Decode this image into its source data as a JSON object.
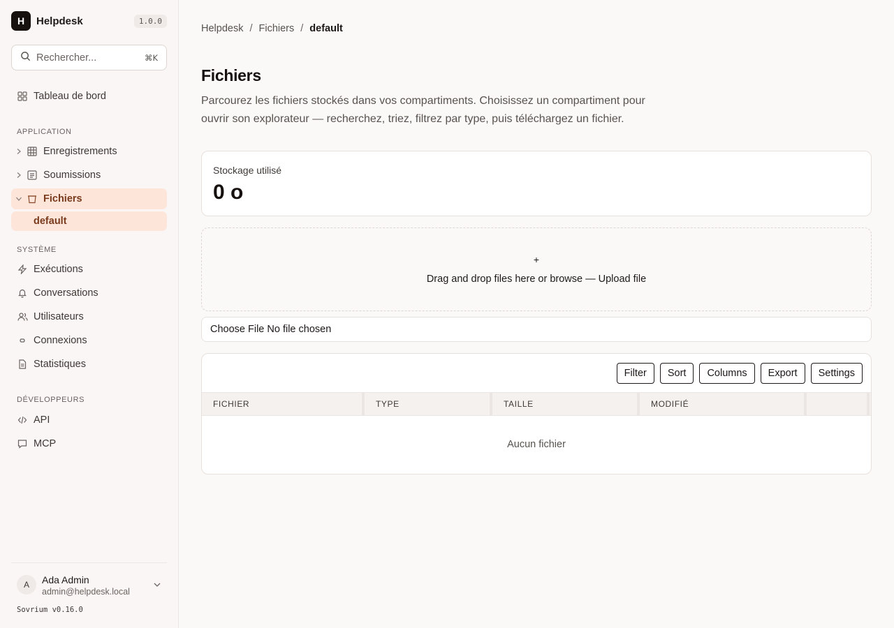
{
  "app": {
    "logo_letter": "H",
    "name": "Helpdesk",
    "version": "1.0.0"
  },
  "search": {
    "placeholder": "Rechercher...",
    "shortcut": "⌘K"
  },
  "sidebar": {
    "dashboard": "Tableau de bord",
    "section_application": "APPLICATION",
    "application_items": [
      "Enregistrements",
      "Soumissions",
      "Fichiers"
    ],
    "active_child": "default",
    "section_system": "SYSTÈME",
    "system_items": [
      "Exécutions",
      "Conversations",
      "Utilisateurs",
      "Connexions",
      "Statistiques"
    ],
    "section_dev": "DÉVELOPPEURS",
    "dev_items": [
      "API",
      "MCP"
    ]
  },
  "user": {
    "initial": "A",
    "name": "Ada Admin",
    "email": "admin@helpdesk.local",
    "app_version": "Sovrium v0.16.0"
  },
  "breadcrumb": [
    "Helpdesk",
    "Fichiers",
    "default"
  ],
  "page": {
    "title": "Fichiers",
    "description": "Parcourez les fichiers stockés dans vos compartiments. Choisissez un compartiment pour ouvrir son explorateur — recherchez, triez, filtrez par type, puis téléchargez un fichier."
  },
  "storage": {
    "label": "Stockage utilisé",
    "value": "0 o"
  },
  "dropzone": {
    "plus": "+",
    "text": "Drag and drop files here or browse — Upload file"
  },
  "file_input": {
    "button": "Choose File",
    "status": "No file chosen"
  },
  "toolbar": [
    "Filter",
    "Sort",
    "Columns",
    "Export",
    "Settings"
  ],
  "table": {
    "columns": [
      "FICHIER",
      "TYPE",
      "TAILLE",
      "MODIFIÉ"
    ],
    "empty": "Aucun fichier"
  }
}
